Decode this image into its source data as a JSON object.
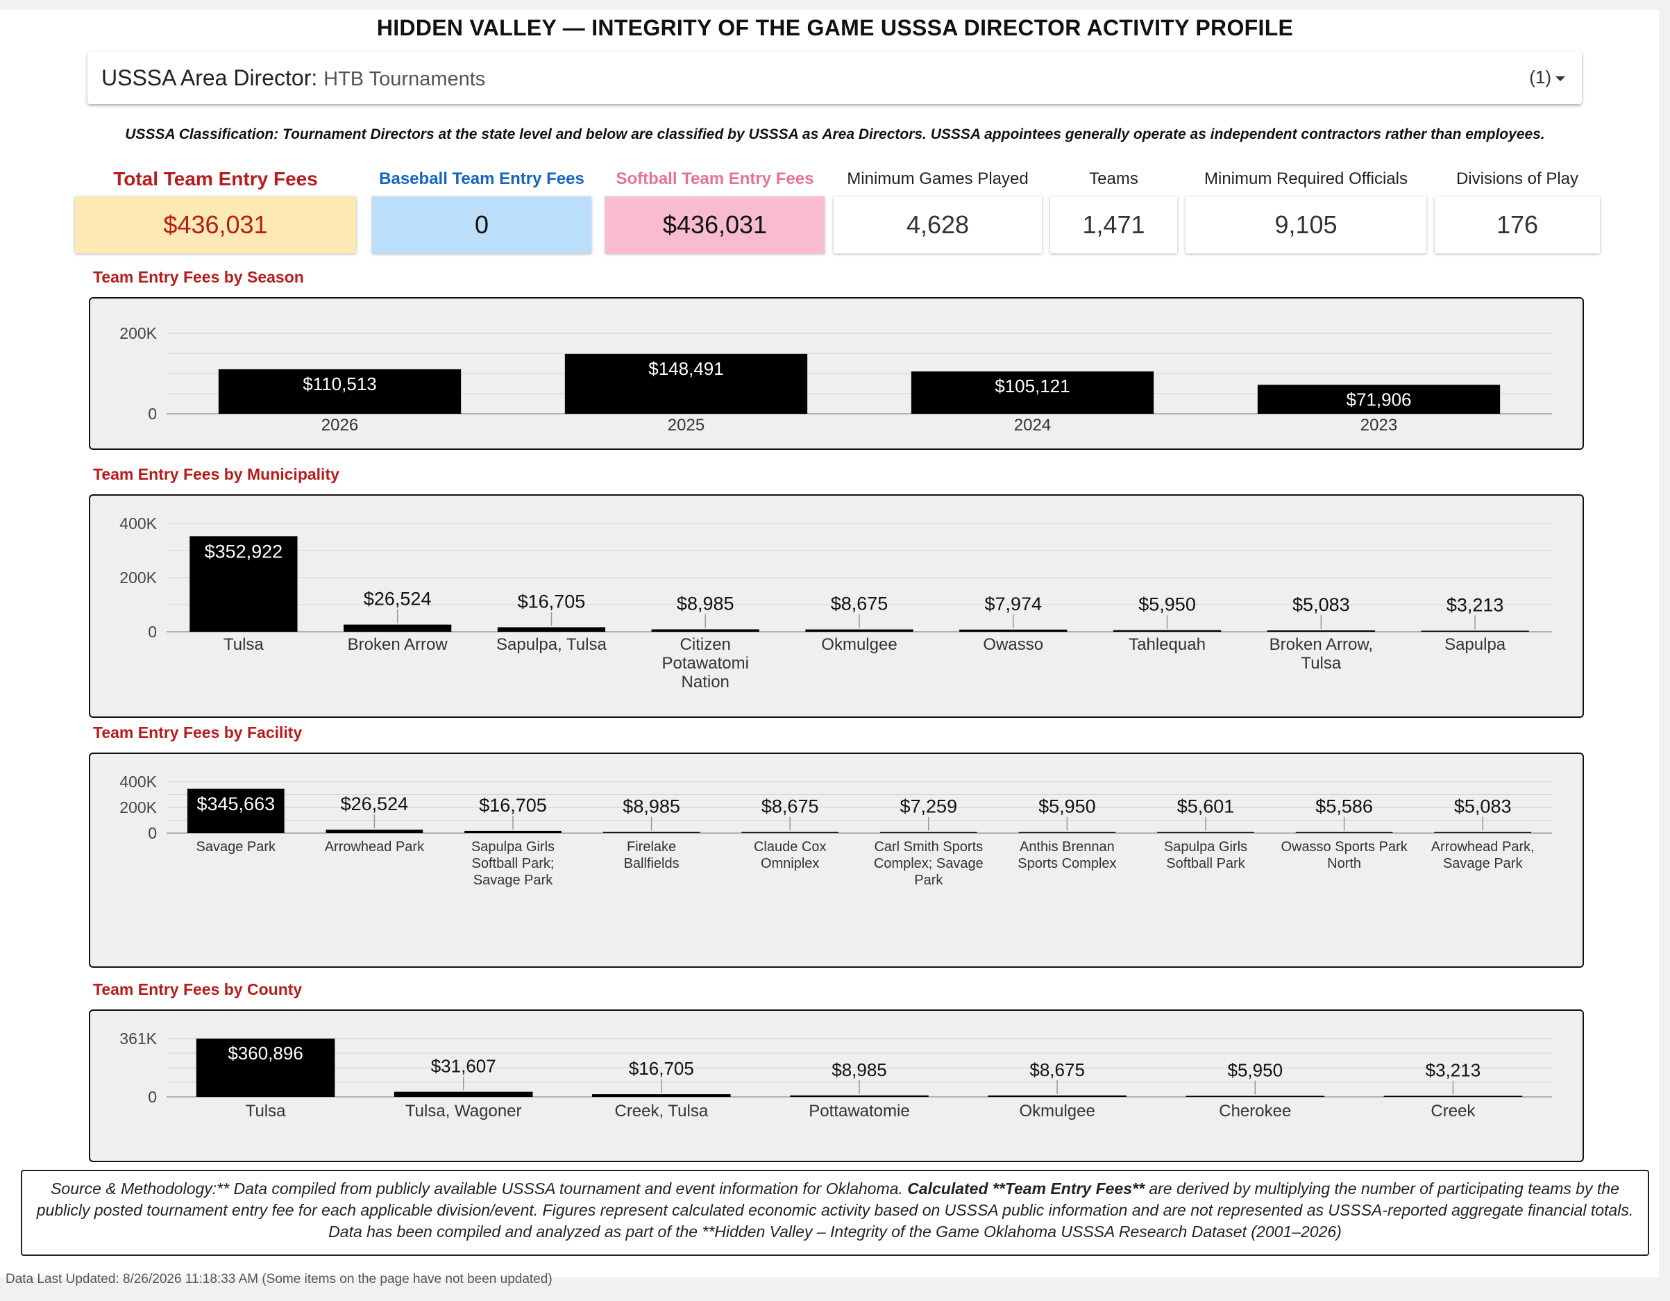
{
  "title": "HIDDEN VALLEY — INTEGRITY OF THE GAME USSSA DIRECTOR ACTIVITY PROFILE",
  "filter": {
    "label": "USSSA Area Director:",
    "value": "HTB Tournaments",
    "count": "(1)"
  },
  "classification": "USSSA Classification: Tournament Directors at the state level and below are classified by USSSA as Area Directors. USSSA appointees generally operate as independent contractors rather than employees.",
  "kpis": [
    {
      "title": "Total Team Entry Fees",
      "value": "$436,031",
      "title_color": "#b71c1c",
      "value_color": "#b71c1c",
      "bg": "#fde9b3"
    },
    {
      "title": "Baseball Team Entry Fees",
      "value": "0",
      "title_color": "#1565c0",
      "value_color": "#111111",
      "bg": "#bbdefb"
    },
    {
      "title": "Softball Team Entry Fees",
      "value": "$436,031",
      "title_color": "#e57399",
      "value_color": "#111111",
      "bg": "#f8bbd0"
    },
    {
      "title": "Minimum Games Played",
      "value": "4,628",
      "title_color": "#222222",
      "value_color": "#333333",
      "bg": "#ffffff"
    },
    {
      "title": "Teams",
      "value": "1,471",
      "title_color": "#222222",
      "value_color": "#333333",
      "bg": "#ffffff"
    },
    {
      "title": "Minimum Required Officials",
      "value": "9,105",
      "title_color": "#222222",
      "value_color": "#333333",
      "bg": "#ffffff"
    },
    {
      "title": "Divisions of Play",
      "value": "176",
      "title_color": "#222222",
      "value_color": "#333333",
      "bg": "#ffffff"
    }
  ],
  "chart_data": [
    {
      "type": "bar",
      "title": "Team Entry Fees by Season",
      "categories": [
        "2026",
        "2025",
        "2024",
        "2023"
      ],
      "values": [
        110513,
        148491,
        105121,
        71906
      ],
      "labels": [
        "$110,513",
        "$148,491",
        "$105,121",
        "$71,906"
      ],
      "ylim": [
        0,
        200000
      ],
      "yticks": [
        {
          "v": 0,
          "t": "0"
        },
        {
          "v": 200000,
          "t": "200K"
        }
      ],
      "grid": true,
      "bar_color": "#000000"
    },
    {
      "type": "bar",
      "title": "Team Entry Fees by Municipality",
      "categories": [
        "Tulsa",
        "Broken Arrow",
        "Sapulpa, Tulsa",
        "Citizen Potawatomi Nation",
        "Okmulgee",
        "Owasso",
        "Tahlequah",
        "Broken Arrow, Tulsa",
        "Sapulpa"
      ],
      "values": [
        352922,
        26524,
        16705,
        8985,
        8675,
        7974,
        5950,
        5083,
        3213
      ],
      "labels": [
        "$352,922",
        "$26,524",
        "$16,705",
        "$8,985",
        "$8,675",
        "$7,974",
        "$5,950",
        "$5,083",
        "$3,213"
      ],
      "ylim": [
        0,
        400000
      ],
      "yticks": [
        {
          "v": 0,
          "t": "0"
        },
        {
          "v": 200000,
          "t": "200K"
        },
        {
          "v": 400000,
          "t": "400K"
        }
      ],
      "grid": true,
      "bar_color": "#000000"
    },
    {
      "type": "bar",
      "title": "Team Entry Fees by Facility",
      "categories": [
        "Savage Park",
        "Arrowhead Park",
        "Sapulpa Girls Softball Park; Savage Park",
        "Firelake Ballfields",
        "Claude Cox Omniplex",
        "Carl Smith Sports Complex; Savage Park",
        "Anthis Brennan Sports Complex",
        "Sapulpa Girls Softball Park",
        "Owasso Sports Park North",
        "Arrowhead Park, Savage Park"
      ],
      "values": [
        345663,
        26524,
        16705,
        8985,
        8675,
        7259,
        5950,
        5601,
        5586,
        5083
      ],
      "labels": [
        "$345,663",
        "$26,524",
        "$16,705",
        "$8,985",
        "$8,675",
        "$7,259",
        "$5,950",
        "$5,601",
        "$5,586",
        "$5,083"
      ],
      "ylim": [
        0,
        400000
      ],
      "yticks": [
        {
          "v": 0,
          "t": "0"
        },
        {
          "v": 200000,
          "t": "200K"
        },
        {
          "v": 400000,
          "t": "400K"
        }
      ],
      "grid": true,
      "bar_color": "#000000"
    },
    {
      "type": "bar",
      "title": "Team Entry Fees by County",
      "categories": [
        "Tulsa",
        "Tulsa, Wagoner",
        "Creek, Tulsa",
        "Pottawatomie",
        "Okmulgee",
        "Cherokee",
        "Creek"
      ],
      "values": [
        360896,
        31607,
        16705,
        8985,
        8675,
        5950,
        3213
      ],
      "labels": [
        "$360,896",
        "$31,607",
        "$16,705",
        "$8,985",
        "$8,675",
        "$5,950",
        "$3,213"
      ],
      "ylim": [
        0,
        361000
      ],
      "yticks": [
        {
          "v": 0,
          "t": "0"
        },
        {
          "v": 361000,
          "t": "361K"
        }
      ],
      "grid": true,
      "bar_color": "#000000"
    }
  ],
  "source": {
    "part1": "Source & Methodology:** Data compiled from publicly available USSSA tournament and event information for Oklahoma. ",
    "bold": "Calculated **Team Entry Fees**",
    "part2": " are derived by multiplying the number of participating teams by the publicly posted tournament entry fee for each applicable division/event. Figures represent calculated economic activity based on USSSA public information and are not represented as USSSA-reported aggregate financial totals. Data has been compiled and analyzed as part of the **Hidden Valley – Integrity of the Game Oklahoma USSSA Research Dataset (2001–2026)"
  },
  "updated": "Data Last Updated: 8/26/2026 11:18:33 AM (Some items on the page have not been updated)"
}
